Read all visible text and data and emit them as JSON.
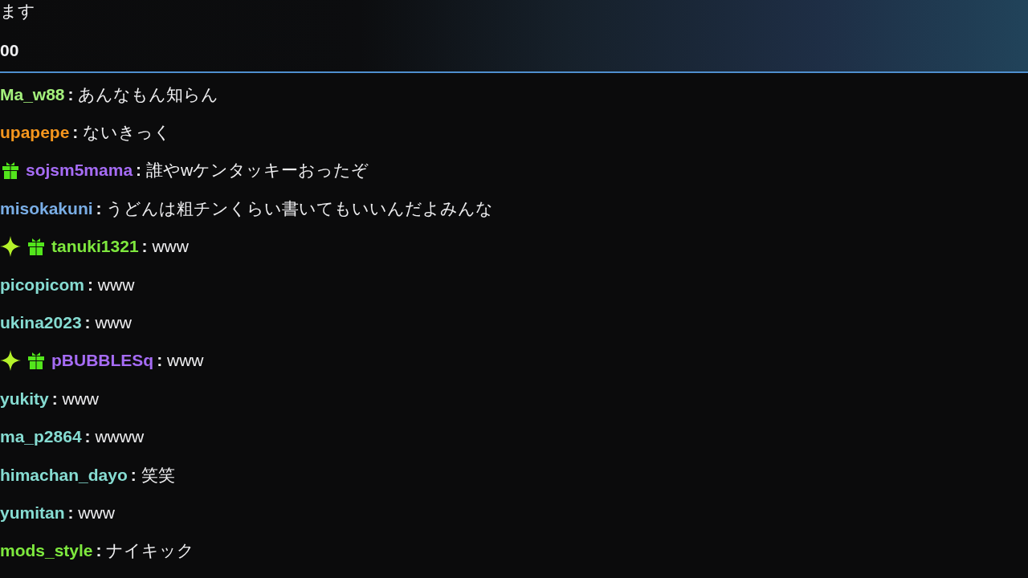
{
  "header": {
    "lines": [
      "ます",
      "00"
    ]
  },
  "messages": [
    {
      "user": "Ma_w88",
      "color": "#a4f07c",
      "text": "**:** あんなもん知らん"
    },
    {
      "user": "upapepe",
      "color": "#f5961e",
      "text": "**:** ないきっく"
    },
    {
      "user": "sojsm5mama",
      "color": "#a66cf5",
      "text": "**:** 誰やwケンタッキーおったぞ",
      "badges": [
        {
          "kind": "gift"
        }
      ]
    },
    {
      "user": "misokakuni",
      "color": "#7aaee6",
      "text": "**:** うどんは粗チンくらい書いてもいいんだよみんな"
    },
    {
      "user": "tanuki1321",
      "color": "#7ee83e",
      "text": "**:** www",
      "badges": [
        {
          "kind": "sparkle"
        },
        {
          "kind": "gift"
        }
      ]
    },
    {
      "user": "picopicom",
      "color": "#86dcd2",
      "text": "**:** www"
    },
    {
      "user": "ukina2023",
      "color": "#86dcd2",
      "text": "**:** www"
    },
    {
      "user": "pBUBBLESq",
      "color": "#a66cf5",
      "text": "**:** www",
      "badges": [
        {
          "kind": "sparkle"
        },
        {
          "kind": "gift"
        }
      ]
    },
    {
      "user": "yukity",
      "color": "#86dcd2",
      "text": "**:** www"
    },
    {
      "user": "ma_p2864",
      "color": "#86dcd2",
      "text": "**:** wwww"
    },
    {
      "user": "himachan_dayo",
      "color": "#86dcd2",
      "text": "**:** 笑笑"
    },
    {
      "user": "yumitan",
      "color": "#86dcd2",
      "text": "**:** www"
    },
    {
      "user": "mods_style",
      "color": "#7ee83e",
      "text": "**:** ナイキック"
    }
  ]
}
